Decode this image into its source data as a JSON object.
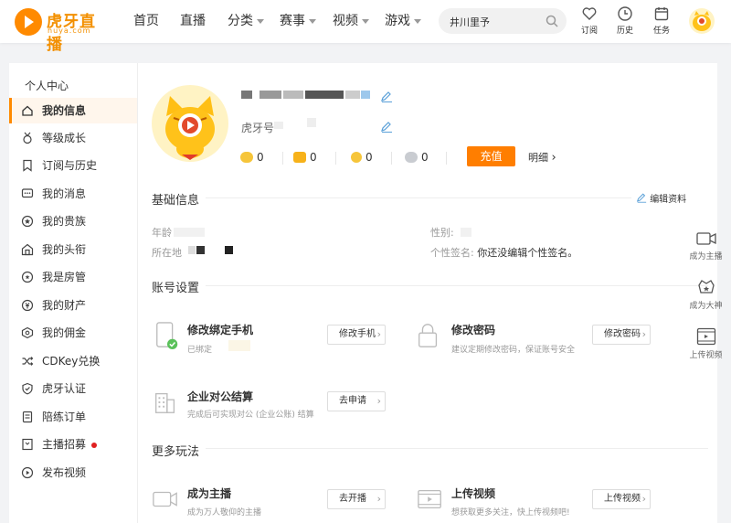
{
  "brand": {
    "name": "虎牙直播",
    "domain": "huya.com",
    "accent": "#ff8a00"
  },
  "nav": [
    {
      "label": "首页",
      "dropdown": false
    },
    {
      "label": "直播",
      "dropdown": false
    },
    {
      "label": "分类",
      "dropdown": true
    },
    {
      "label": "赛事",
      "dropdown": true
    },
    {
      "label": "视频",
      "dropdown": true
    },
    {
      "label": "游戏",
      "dropdown": true
    }
  ],
  "search": {
    "value": "井川里予"
  },
  "toolbar": {
    "subscribe": "订阅",
    "history": "历史",
    "tasks": "任务"
  },
  "sidebar": {
    "title": "个人中心",
    "items": [
      {
        "label": "我的信息",
        "icon": "home-icon",
        "active": true
      },
      {
        "label": "等级成长",
        "icon": "medal-icon"
      },
      {
        "label": "订阅与历史",
        "icon": "bookmark-icon"
      },
      {
        "label": "我的消息",
        "icon": "message-icon"
      },
      {
        "label": "我的贵族",
        "icon": "star-badge-icon"
      },
      {
        "label": "我的头衔",
        "icon": "title-icon"
      },
      {
        "label": "我是房管",
        "icon": "shield-star-icon"
      },
      {
        "label": "我的财产",
        "icon": "wallet-icon"
      },
      {
        "label": "我的佣金",
        "icon": "coin-icon"
      },
      {
        "label": "CDKey兑换",
        "icon": "shuffle-icon"
      },
      {
        "label": "虎牙认证",
        "icon": "verify-icon"
      },
      {
        "label": "陪练订单",
        "icon": "order-icon"
      },
      {
        "label": "主播招募",
        "icon": "flag-icon",
        "dot": true
      },
      {
        "label": "发布视频",
        "icon": "play-circle-icon"
      }
    ]
  },
  "profile": {
    "huya_id_label": "虎牙号",
    "assets": [
      "0",
      "0",
      "0",
      "0"
    ],
    "recharge": "充值",
    "detail": "明细"
  },
  "basic_info": {
    "title": "基础信息",
    "edit": "编辑资料",
    "age_label": "年龄",
    "gender_label": "性别:",
    "location_label": "所在地",
    "signature_label": "个性签名:",
    "signature_value": "你还没编辑个性签名。"
  },
  "account": {
    "title": "账号设置",
    "items": [
      {
        "title": "修改绑定手机",
        "sub": "已绑定",
        "button": "修改手机",
        "icon": "phone-icon"
      },
      {
        "title": "修改密码",
        "sub": "建议定期修改密码，保证账号安全",
        "button": "修改密码",
        "icon": "lock-icon"
      },
      {
        "title": "企业对公结算",
        "sub": "完成后可实现对公 (企业公账) 结算",
        "button": "去申请",
        "icon": "building-icon"
      }
    ]
  },
  "more": {
    "title": "更多玩法",
    "items": [
      {
        "title": "成为主播",
        "sub": "成为万人敬仰的主播",
        "button": "去开播",
        "icon": "camera-icon"
      },
      {
        "title": "上传视频",
        "sub": "想获取更多关注，快上传视频吧!",
        "button": "上传视频",
        "icon": "film-icon"
      }
    ]
  },
  "dock": [
    {
      "label": "成为主播",
      "icon": "camera-icon"
    },
    {
      "label": "成为大神",
      "icon": "crown-icon"
    },
    {
      "label": "上传视频",
      "icon": "upload-video-icon"
    }
  ]
}
